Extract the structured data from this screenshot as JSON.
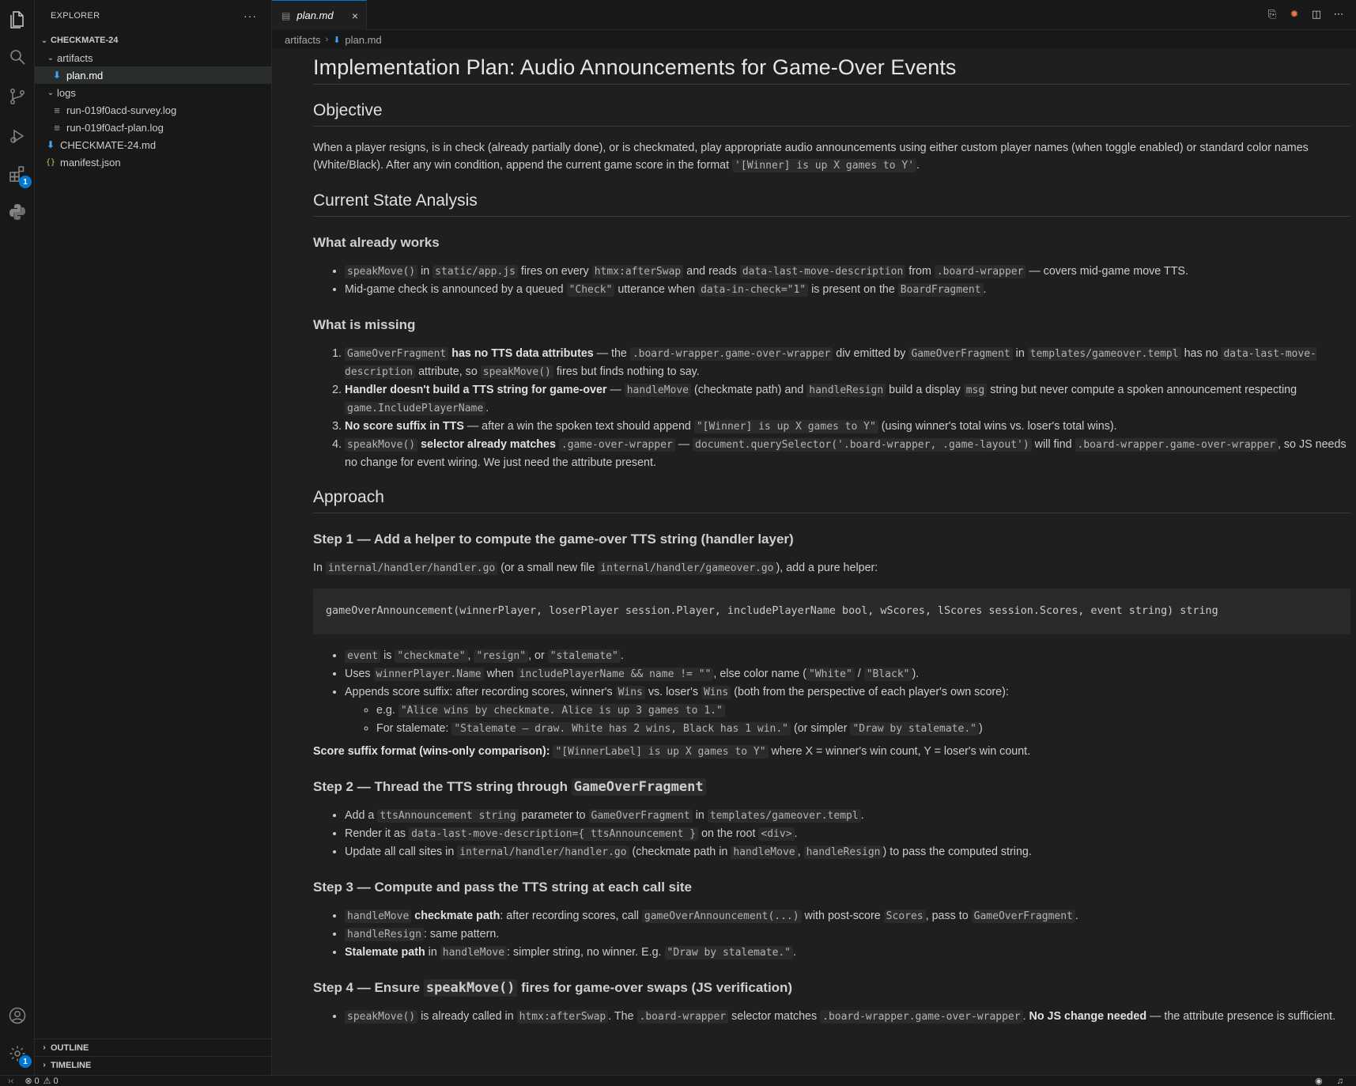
{
  "sidebar": {
    "title": "EXPLORER",
    "more": "···",
    "root": "CHECKMATE-24",
    "items": [
      {
        "label": "artifacts"
      },
      {
        "label": "plan.md"
      },
      {
        "label": "logs"
      },
      {
        "label": "run-019f0acd-survey.log"
      },
      {
        "label": "run-019f0acf-plan.log"
      },
      {
        "label": "CHECKMATE-24.md"
      },
      {
        "label": "manifest.json"
      }
    ],
    "outline": "OUTLINE",
    "timeline": "TIMELINE"
  },
  "activity": {
    "extensions_badge": "1",
    "settings_badge": "1"
  },
  "tabs": [
    {
      "label": "plan.md"
    }
  ],
  "breadcrumb": [
    "artifacts",
    "plan.md"
  ],
  "status": {
    "errors": "0",
    "warnings": "0"
  },
  "doc": {
    "title": "Implementation Plan: Audio Announcements for Game-Over Events",
    "objective": {
      "heading": "Objective",
      "text1": "When a player resigns, is in check (already partially done), or is checkmated, play appropriate audio announcements using either custom player names (when toggle enabled) or standard color names (White/Black). After any win condition, append the current game score in the format ",
      "code1": "'[Winner] is up X games to Y'",
      "text2": "."
    },
    "current": {
      "heading": "Current State Analysis",
      "works_heading": "What already works",
      "works": [
        {
          "c1": "speakMove()",
          "t1": " in ",
          "c2": "static/app.js",
          "t2": " fires on every ",
          "c3": "htmx:afterSwap",
          "t3": " and reads ",
          "c4": "data-last-move-description",
          "t4": " from ",
          "c5": ".board-wrapper",
          "t5": " — covers mid-game move TTS."
        },
        {
          "t0": "Mid-game check is announced by a queued ",
          "c1": "\"Check\"",
          "t1": " utterance when ",
          "c2": "data-in-check=\"1\"",
          "t2": " is present on the ",
          "c3": "BoardFragment",
          "t3": "."
        }
      ],
      "missing_heading": "What is missing",
      "missing": [
        {
          "c1": "GameOverFragment",
          "b1": " has no TTS data attributes",
          "t1": " — the ",
          "c2": ".board-wrapper.game-over-wrapper",
          "t2": " div emitted by ",
          "c3": "GameOverFragment",
          "t3": " in ",
          "c4": "templates/gameover.templ",
          "t4": " has no ",
          "c5": "data-last-move-description",
          "t5": " attribute, so ",
          "c6": "speakMove()",
          "t6": " fires but finds nothing to say."
        },
        {
          "b1": "Handler doesn't build a TTS string for game-over",
          "t1": " — ",
          "c1": "handleMove",
          "t2": " (checkmate path) and ",
          "c2": "handleResign",
          "t3": " build a display ",
          "c3": "msg",
          "t4": " string but never compute a spoken announcement respecting ",
          "c4": "game.IncludePlayerName",
          "t5": "."
        },
        {
          "b1": "No score suffix in TTS",
          "t1": " — after a win the spoken text should append ",
          "c1": "\"[Winner] is up X games to Y\"",
          "t2": " (using winner's total wins vs. loser's total wins)."
        },
        {
          "c1": "speakMove()",
          "b1": " selector already matches ",
          "c2": ".game-over-wrapper",
          "t1": " — ",
          "c3": "document.querySelector('.board-wrapper, .game-layout')",
          "t2": " will find ",
          "c4": ".board-wrapper.game-over-wrapper",
          "t3": ", so JS needs no change for event wiring. We just need the attribute present."
        }
      ]
    },
    "approach": {
      "heading": "Approach",
      "step1": {
        "heading": "Step 1 — Add a helper to compute the game-over TTS string (handler layer)",
        "intro_t1": "In ",
        "intro_c1": "internal/handler/handler.go",
        "intro_t2": " (or a small new file ",
        "intro_c2": "internal/handler/gameover.go",
        "intro_t3": "), add a pure helper:",
        "code": "gameOverAnnouncement(winnerPlayer, loserPlayer session.Player, includePlayerName bool, wScores, lScores session.Scores, event string) string",
        "bullets": [
          {
            "c1": "event",
            "t1": " is ",
            "c2": "\"checkmate\"",
            "t2": ", ",
            "c3": "\"resign\"",
            "t3": ", or ",
            "c4": "\"stalemate\"",
            "t4": "."
          },
          {
            "t0": "Uses ",
            "c1": "winnerPlayer.Name",
            "t1": " when ",
            "c2": "includePlayerName && name != \"\"",
            "t2": ", else color name (",
            "c3": "\"White\"",
            "t3": " / ",
            "c4": "\"Black\"",
            "t4": ")."
          },
          {
            "t0": "Appends score suffix: after recording scores, winner's ",
            "c1": "Wins",
            "t1": " vs. loser's ",
            "c2": "Wins",
            "t2": " (both from the perspective of each player's own score):"
          }
        ],
        "sub": [
          {
            "t0": "e.g. ",
            "c1": "\"Alice wins by checkmate. Alice is up 3 games to 1.\""
          },
          {
            "t0": "For stalemate: ",
            "c1": "\"Stalemate — draw. White has 2 wins, Black has 1 win.\"",
            "t1": " (or simpler ",
            "c2": "\"Draw by stalemate.\"",
            "t2": ")"
          }
        ],
        "suffix_b": "Score suffix format (wins-only comparison):",
        "suffix_t1": " ",
        "suffix_c": "\"[WinnerLabel] is up X games to Y\"",
        "suffix_t2": " where X = winner's win count, Y = loser's win count."
      },
      "step2": {
        "heading_t": "Step 2 — Thread the TTS string through ",
        "heading_c": "GameOverFragment",
        "bullets": [
          {
            "t0": "Add a ",
            "c1": "ttsAnnouncement string",
            "t1": " parameter to ",
            "c2": "GameOverFragment",
            "t2": " in ",
            "c3": "templates/gameover.templ",
            "t3": "."
          },
          {
            "t0": "Render it as ",
            "c1": "data-last-move-description={ ttsAnnouncement }",
            "t1": " on the root ",
            "c2": "<div>",
            "t2": "."
          },
          {
            "t0": "Update all call sites in ",
            "c1": "internal/handler/handler.go",
            "t1": " (checkmate path in ",
            "c2": "handleMove",
            "t2": ", ",
            "c3": "handleResign",
            "t3": ") to pass the computed string."
          }
        ]
      },
      "step3": {
        "heading": "Step 3 — Compute and pass the TTS string at each call site",
        "bullets": [
          {
            "c1": "handleMove",
            "b1": " checkmate path",
            "t1": ": after recording scores, call ",
            "c2": "gameOverAnnouncement(...)",
            "t2": " with post-score ",
            "c3": "Scores",
            "t3": ", pass to ",
            "c4": "GameOverFragment",
            "t4": "."
          },
          {
            "c1": "handleResign",
            "t1": ": same pattern."
          },
          {
            "b1": "Stalemate path",
            "t1": " in ",
            "c1": "handleMove",
            "t2": ": simpler string, no winner. E.g. ",
            "c2": "\"Draw by stalemate.\"",
            "t3": "."
          }
        ]
      },
      "step4": {
        "heading_t1": "Step 4 — Ensure ",
        "heading_c": "speakMove()",
        "heading_t2": " fires for game-over swaps (JS verification)",
        "bullets": [
          {
            "c1": "speakMove()",
            "t1": " is already called in ",
            "c2": "htmx:afterSwap",
            "t2": ". The ",
            "c3": ".board-wrapper",
            "t3": " selector matches ",
            "c4": ".board-wrapper.game-over-wrapper",
            "t4": ". ",
            "b1": "No JS change needed",
            "t5": " — the attribute presence is sufficient."
          }
        ]
      }
    }
  }
}
